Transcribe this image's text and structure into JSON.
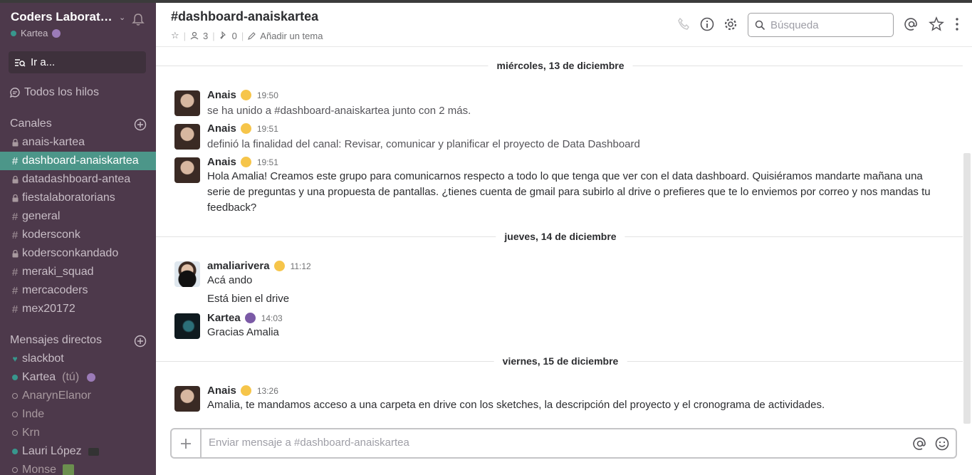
{
  "team": {
    "name": "Coders Laborat…",
    "user": "Kartea"
  },
  "jump": {
    "label": "Ir a..."
  },
  "all_threads": "Todos los hilos",
  "channels": {
    "title": "Canales",
    "items": [
      {
        "prefix": "lock",
        "name": "anais-kartea",
        "active": false
      },
      {
        "prefix": "#",
        "name": "dashboard-anaiskartea",
        "active": true
      },
      {
        "prefix": "lock",
        "name": "datadashboard-antea",
        "active": false
      },
      {
        "prefix": "lock",
        "name": "fiestalaboratorians",
        "active": false
      },
      {
        "prefix": "#",
        "name": "general",
        "active": false
      },
      {
        "prefix": "#",
        "name": "kodersconk",
        "active": false
      },
      {
        "prefix": "lock",
        "name": "kodersconkandado",
        "active": false
      },
      {
        "prefix": "#",
        "name": "meraki_squad",
        "active": false
      },
      {
        "prefix": "#",
        "name": "mercacoders",
        "active": false
      },
      {
        "prefix": "#",
        "name": "mex20172",
        "active": false
      }
    ]
  },
  "dms": {
    "title": "Mensajes directos",
    "items": [
      {
        "status": "heart",
        "name": "slackbot"
      },
      {
        "status": "online",
        "name": "Kartea",
        "suffix": "(tú)"
      },
      {
        "status": "offline",
        "name": "AnarynElanor"
      },
      {
        "status": "offline",
        "name": "Inde"
      },
      {
        "status": "offline",
        "name": "Krn"
      },
      {
        "status": "online",
        "name": "Lauri López"
      },
      {
        "status": "offline",
        "name": "Monse"
      }
    ]
  },
  "header": {
    "title": "#dashboard-anaiskartea",
    "members": "3",
    "pins": "0",
    "topic": "Añadir un tema",
    "search_placeholder": "Búsqueda"
  },
  "days": [
    {
      "label": "miércoles, 13 de diciembre"
    },
    {
      "label": "jueves, 14 de diciembre"
    },
    {
      "label": "viernes, 15 de diciembre"
    }
  ],
  "messages": [
    {
      "author": "Anais",
      "time": "19:50",
      "text": "se ha unido a #dashboard-anaiskartea junto con 2 más.",
      "text2": ""
    },
    {
      "author": "Anais",
      "time": "19:51",
      "text": "definió la finalidad del canal: Revisar, comunicar y planificar el proyecto de Data Dashboard",
      "text2": ""
    },
    {
      "author": "Anais",
      "time": "19:51",
      "text": "Hola Amalia! Creamos este grupo para comunicarnos respecto a todo lo que tenga que ver con el data dashboard. Quisiéramos mandarte mañana una serie de preguntas y una propuesta de pantallas. ¿tienes cuenta de gmail para subirlo al drive o prefieres que te lo enviemos por correo y nos mandas tu feedback?",
      "text2": ""
    },
    {
      "author": "amaliarivera",
      "time": "11:12",
      "text": "Acá ando",
      "text2": "Está bien el drive"
    },
    {
      "author": "Kartea",
      "time": "14:03",
      "text": "Gracias Amalia",
      "text2": ""
    },
    {
      "author": "Anais",
      "time": "13:26",
      "text": "Amalia, te mandamos acceso a una carpeta en drive con los sketches, la descripción del proyecto y el cronograma de actividades.",
      "text2": ""
    }
  ],
  "composer": {
    "placeholder": "Enviar mensaje a #dashboard-anaiskartea"
  },
  "colors": {
    "sidebar": "#4d394b",
    "active_channel": "#4c9689",
    "online": "#38978d"
  }
}
